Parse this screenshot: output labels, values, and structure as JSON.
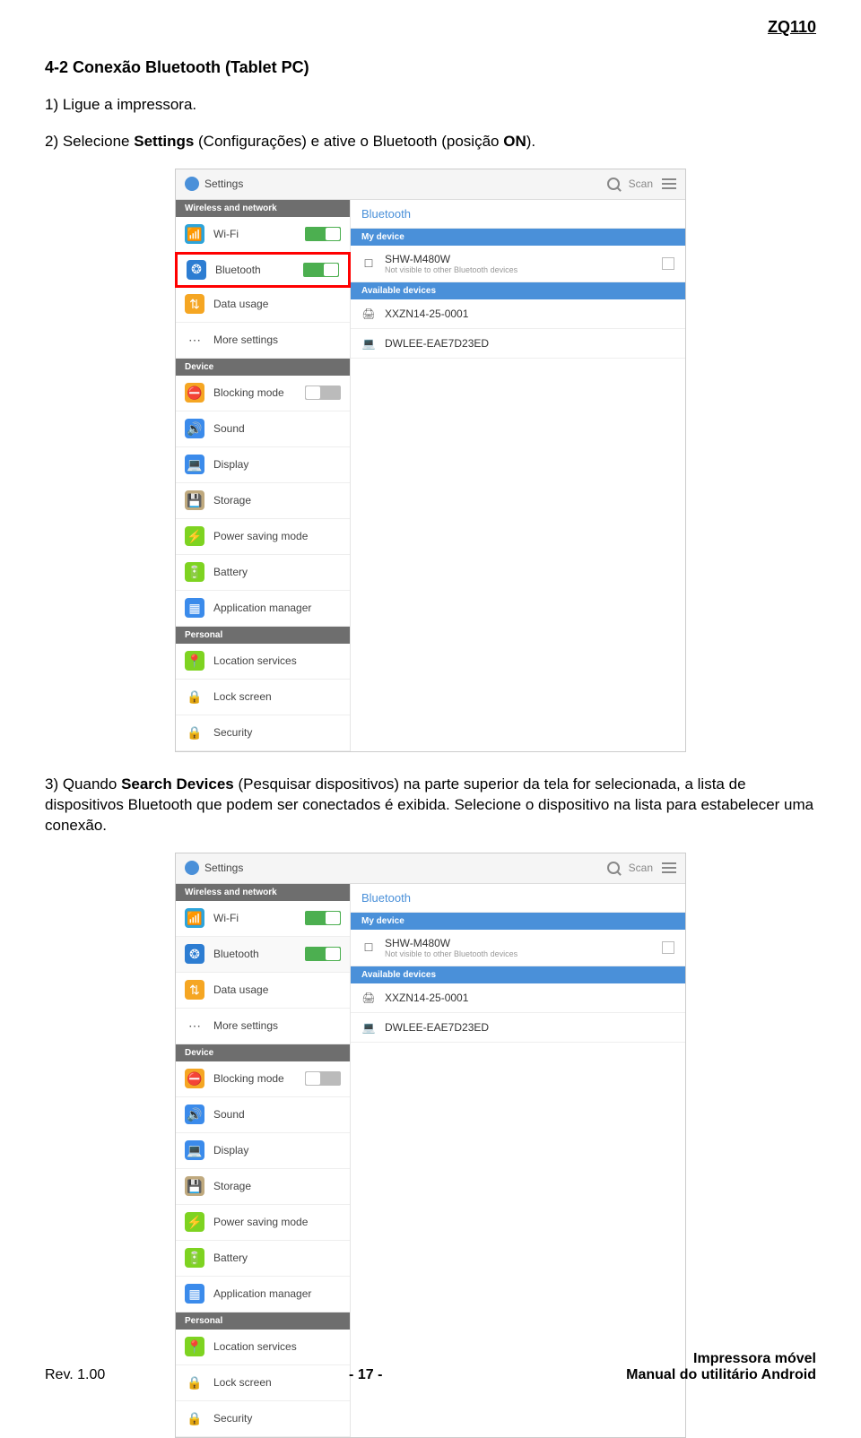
{
  "header": {
    "model": "ZQ110"
  },
  "section_title": "4-2 Conexão Bluetooth (Tablet PC)",
  "steps": {
    "s1": "1) Ligue a impressora.",
    "s2_pre": "2) Selecione ",
    "s2_b": "Settings",
    "s2_mid": " (Configurações) e ative o Bluetooth (posição ",
    "s2_b2": "ON",
    "s2_post": ").",
    "s3_pre": "3) Quando ",
    "s3_b": "Search Devices",
    "s3_mid": " (Pesquisar dispositivos) na parte superior da tela for selecionada, a lista de dispositivos Bluetooth que podem ser conectados é exibida. Selecione o dispositivo na lista para estabelecer uma conexão."
  },
  "ui": {
    "title": "Settings",
    "scan": "Scan",
    "sections": {
      "wireless": "Wireless and network",
      "device": "Device",
      "personal": "Personal"
    },
    "sidebar": [
      {
        "label": "Wi-Fi",
        "toggle": true
      },
      {
        "label": "Bluetooth",
        "toggle": true
      },
      {
        "label": "Data usage"
      },
      {
        "label": "More settings"
      },
      {
        "label": "Blocking mode",
        "toggle_off": true
      },
      {
        "label": "Sound"
      },
      {
        "label": "Display"
      },
      {
        "label": "Storage"
      },
      {
        "label": "Power saving mode"
      },
      {
        "label": "Battery"
      },
      {
        "label": "Application manager"
      },
      {
        "label": "Location services"
      },
      {
        "label": "Lock screen"
      },
      {
        "label": "Security"
      }
    ],
    "panel": {
      "bt_title": "Bluetooth",
      "my_device": "My device",
      "my_name": "SHW-M480W",
      "my_sub": "Not visible to other Bluetooth devices",
      "avail": "Available devices",
      "dev1": "XXZN14-25-0001",
      "dev2": "DWLEE-EAE7D23ED"
    }
  },
  "footer": {
    "rev": "Rev.  1.00",
    "page": "-  17  -",
    "title1": "Impressora móvel",
    "title2": "Manual do utilitário Android"
  }
}
